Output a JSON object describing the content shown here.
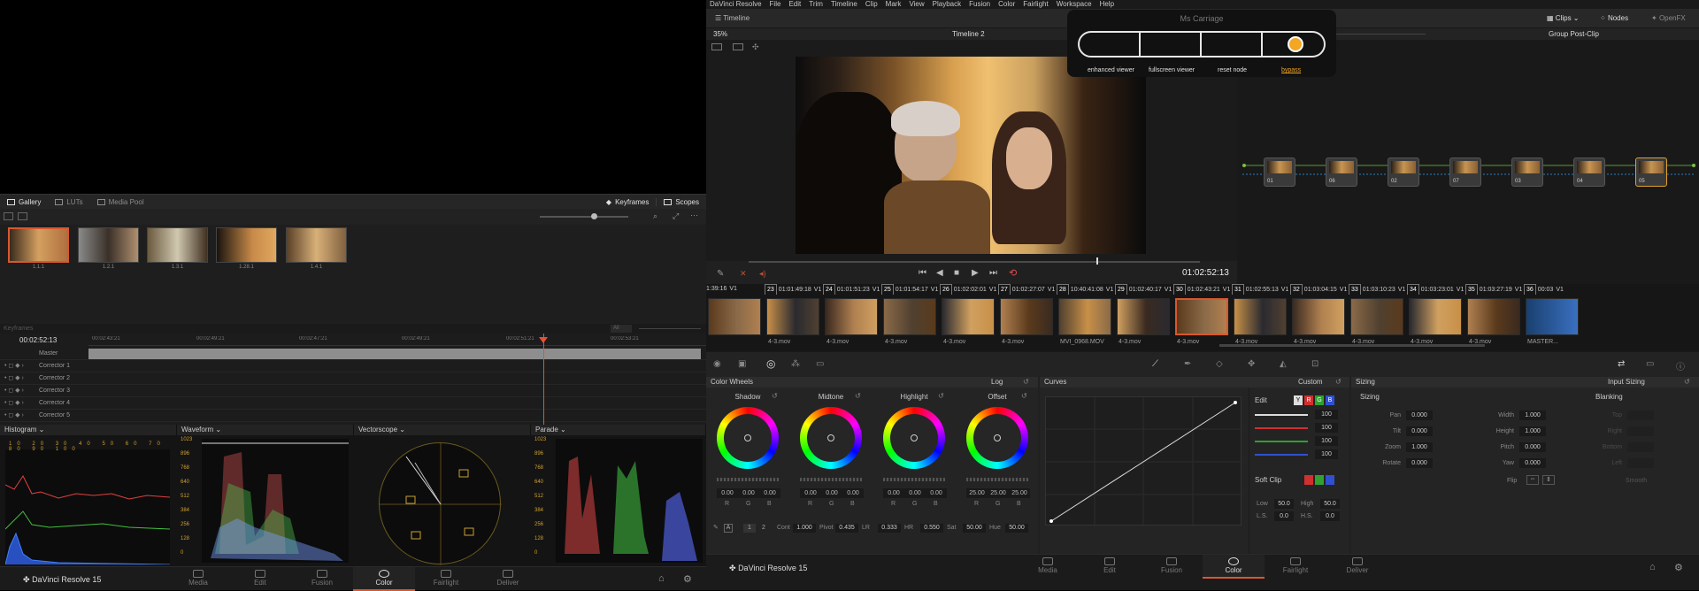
{
  "left": {
    "gallery_tabs": [
      "Gallery",
      "LUTs",
      "Media Pool"
    ],
    "right_tabs": [
      "Keyframes",
      "Scopes"
    ],
    "stills": [
      "1.1.1",
      "1.2.1",
      "1.3.1",
      "1.28.1",
      "1.4.1"
    ],
    "kf_label": "Keyframes",
    "kf_filter": "All",
    "timecode": "00:02:52:13",
    "ruler": [
      "00:02:43:21",
      "00:02:49:21",
      "00:02:47:21",
      "00:02:49:21",
      "00:02:51:21",
      "00:02:53:21"
    ],
    "tracks": [
      "Master",
      "Corrector 1",
      "Corrector 2",
      "Corrector 3",
      "Corrector 4",
      "Corrector 5"
    ],
    "scopes": [
      "Histogram",
      "Waveform",
      "Vectorscope",
      "Parade"
    ],
    "histogram_ticks": [
      "10",
      "20",
      "30",
      "40",
      "50",
      "60",
      "70",
      "80",
      "90",
      "100"
    ],
    "wave_ticks": [
      "1023",
      "896",
      "768",
      "640",
      "512",
      "384",
      "256",
      "128",
      "0"
    ],
    "app": "DaVinci Resolve 15",
    "pages": [
      "Media",
      "Edit",
      "Fusion",
      "Color",
      "Fairlight",
      "Deliver"
    ]
  },
  "right": {
    "menu": [
      "DaVinci Resolve",
      "File",
      "Edit",
      "Trim",
      "Timeline",
      "Clip",
      "Mark",
      "View",
      "Playback",
      "Fusion",
      "Color",
      "Fairlight",
      "Workspace",
      "Help"
    ],
    "timeline_btn": "Timeline",
    "clips_btn": "Clips",
    "nodes_btn": "Nodes",
    "openfx_btn": "OpenFX",
    "zoom": "35%",
    "timeline_name": "Timeline 2",
    "group": "Group Post-Clip",
    "viewer_tc": "01:02:52:13",
    "nodes": [
      "01",
      "06",
      "02",
      "07",
      "03",
      "04",
      "05"
    ],
    "thumbs": [
      {
        "n": "",
        "tc": "1:39:16",
        "f": ""
      },
      {
        "n": "23",
        "tc": "01:01:49:18",
        "f": "4-3.mov"
      },
      {
        "n": "24",
        "tc": "01:01:51:23",
        "f": "4-3.mov"
      },
      {
        "n": "25",
        "tc": "01:01:54:17",
        "f": "4-3.mov"
      },
      {
        "n": "26",
        "tc": "01:02:02:01",
        "f": "4-3.mov"
      },
      {
        "n": "27",
        "tc": "01:02:27:07",
        "f": "4-3.mov"
      },
      {
        "n": "28",
        "tc": "10:40:41:08",
        "f": "MVI_0968.MOV"
      },
      {
        "n": "29",
        "tc": "01:02:40:17",
        "f": "4-3.mov"
      },
      {
        "n": "30",
        "tc": "01:02:43:21",
        "f": "4-3.mov"
      },
      {
        "n": "31",
        "tc": "01:02:55:13",
        "f": "4-3.mov"
      },
      {
        "n": "32",
        "tc": "01:03:04:15",
        "f": "4-3.mov"
      },
      {
        "n": "33",
        "tc": "01:03:10:23",
        "f": "4-3.mov"
      },
      {
        "n": "34",
        "tc": "01:03:23:01",
        "f": "4-3.mov"
      },
      {
        "n": "35",
        "tc": "01:03:27:19",
        "f": "4-3.mov"
      },
      {
        "n": "36",
        "tc": "00:03",
        "f": "MASTER..."
      }
    ],
    "track": "V1",
    "wheels_title": "Color Wheels",
    "wheels_mode": "Log",
    "wheels": [
      {
        "name": "Shadow",
        "vals": [
          "0.00",
          "0.00",
          "0.00"
        ]
      },
      {
        "name": "Midtone",
        "vals": [
          "0.00",
          "0.00",
          "0.00"
        ]
      },
      {
        "name": "Highlight",
        "vals": [
          "0.00",
          "0.00",
          "0.00"
        ]
      },
      {
        "name": "Offset",
        "vals": [
          "25.00",
          "25.00",
          "25.00"
        ]
      }
    ],
    "rgb": [
      "R",
      "G",
      "B"
    ],
    "adj": [
      {
        "l": "Cont",
        "v": "1.000"
      },
      {
        "l": "Pivot",
        "v": "0.435"
      },
      {
        "l": "LR",
        "v": "0.333"
      },
      {
        "l": "HR",
        "v": "0.550"
      },
      {
        "l": "Sat",
        "v": "50.00"
      },
      {
        "l": "Hue",
        "v": "50.00"
      }
    ],
    "pages_12": [
      "1",
      "2"
    ],
    "curves_title": "Curves",
    "curves_mode": "Custom",
    "edit_label": "Edit",
    "ch": [
      "Y",
      "R",
      "G",
      "B"
    ],
    "ch_vals": [
      "100",
      "100",
      "100",
      "100"
    ],
    "soft_clip": "Soft Clip",
    "low": "Low",
    "low_v": "50.0",
    "high": "High",
    "high_v": "50.0",
    "ls": "L.S.",
    "ls_v": "0.0",
    "hs": "H.S.",
    "hs_v": "0.0",
    "sizing_title": "Sizing",
    "sizing_mode": "Input Sizing",
    "sizing_sub": "Sizing",
    "blanking": "Blanking",
    "sizing_left": [
      {
        "l": "Pan",
        "v": "0.000"
      },
      {
        "l": "Tilt",
        "v": "0.000"
      },
      {
        "l": "Zoom",
        "v": "1.000"
      },
      {
        "l": "Rotate",
        "v": "0.000"
      }
    ],
    "sizing_right": [
      {
        "l": "Width",
        "v": "1.000"
      },
      {
        "l": "Height",
        "v": "1.000"
      },
      {
        "l": "Pitch",
        "v": "0.000"
      },
      {
        "l": "Yaw",
        "v": "0.000"
      }
    ],
    "flip": "Flip",
    "blank_labels": [
      "Top",
      "Right",
      "Bottom",
      "Left"
    ],
    "smooth": "Smooth",
    "app": "DaVinci Resolve 15",
    "pages": [
      "Media",
      "Edit",
      "Fusion",
      "Color",
      "Fairlight",
      "Deliver"
    ]
  },
  "popup": {
    "title": "Ms Carriage",
    "buttons": [
      "enhanced viewer",
      "fullscreen viewer",
      "reset node",
      "bypass"
    ],
    "accent": "#f5a623"
  }
}
